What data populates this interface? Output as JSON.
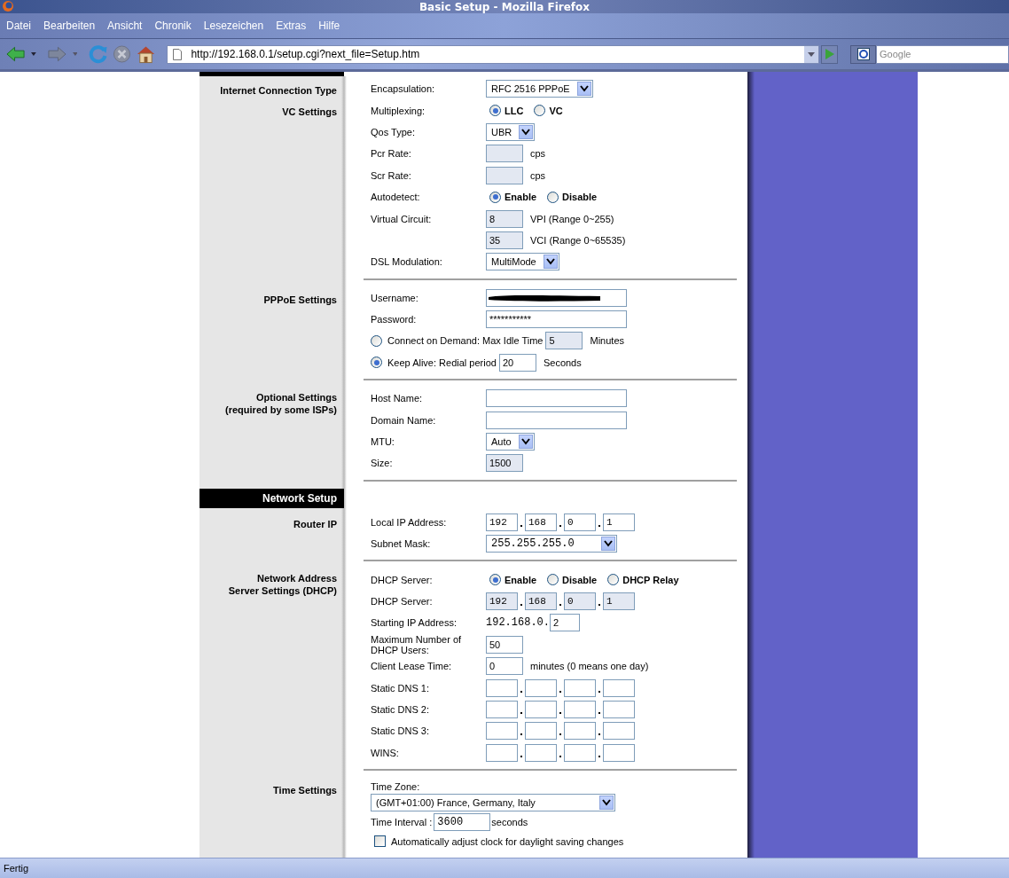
{
  "window": {
    "title": "Basic Setup - Mozilla Firefox"
  },
  "menu": [
    "Datei",
    "Bearbeiten",
    "Ansicht",
    "Chronik",
    "Lesezeichen",
    "Extras",
    "Hilfe"
  ],
  "toolbar": {
    "url": "http://192.168.0.1/setup.cgi?next_file=Setup.htm",
    "search_placeholder": "Google"
  },
  "groups": [
    {
      "kind": "group",
      "heading": [
        "Internet Connection Type"
      ],
      "divider": false,
      "rows": [
        {
          "kind": "select",
          "label": "Encapsulation:",
          "value": "RFC 2516 PPPoE"
        }
      ]
    },
    {
      "kind": "group",
      "heading": [
        "VC Settings"
      ],
      "divider": true,
      "rows": [
        {
          "kind": "radio",
          "label": "Multiplexing:",
          "options": [
            {
              "label": "LLC",
              "selected": true
            },
            {
              "label": "VC",
              "selected": false
            }
          ]
        },
        {
          "kind": "select",
          "label": "Qos Type:",
          "value": "UBR"
        },
        {
          "kind": "field",
          "label": "Pcr Rate:",
          "suffix": "cps",
          "disabled": true
        },
        {
          "kind": "field",
          "label": "Scr Rate:",
          "suffix": "cps",
          "disabled": true
        },
        {
          "kind": "radio",
          "label": "Autodetect:",
          "options": [
            {
              "label": "Enable",
              "selected": true
            },
            {
              "label": "Disable",
              "selected": false
            }
          ]
        },
        {
          "kind": "field",
          "label": "Virtual Circuit:",
          "value": "8",
          "suffix": "VPI (Range 0~255)",
          "disabled": true
        },
        {
          "kind": "field",
          "value": "35",
          "suffix": "VCI (Range 0~65535)",
          "disabled": true
        },
        {
          "kind": "select",
          "label": "DSL Modulation:",
          "value": "MultiMode"
        }
      ]
    },
    {
      "kind": "group",
      "heading": [
        "PPPoE Settings"
      ],
      "divider": true,
      "rows": [
        {
          "kind": "text",
          "label": "Username:",
          "redacted": true
        },
        {
          "kind": "text",
          "label": "Password:",
          "value": "***********",
          "redacted": false
        },
        {
          "kind": "radio-field",
          "label": "Connect on Demand: Max Idle Time",
          "selected": false,
          "value": "5",
          "suffix": "Minutes",
          "disabled": true
        },
        {
          "kind": "radio-field",
          "label": "Keep Alive: Redial period",
          "selected": true,
          "value": "20",
          "suffix": "Seconds",
          "disabled": false
        }
      ]
    },
    {
      "kind": "group",
      "heading": [
        "Optional Settings",
        "(required by some ISPs)"
      ],
      "divider": true,
      "rows": [
        {
          "kind": "text",
          "label": "Host Name:",
          "redacted": false
        },
        {
          "kind": "text",
          "label": "Domain Name:",
          "redacted": false
        },
        {
          "kind": "select",
          "label": "MTU:",
          "value": "Auto"
        },
        {
          "kind": "field",
          "label": "Size:",
          "value": "1500",
          "disabled": true
        }
      ]
    },
    {
      "kind": "section",
      "heading": [
        "Network Setup"
      ]
    },
    {
      "kind": "group",
      "heading": [
        "Router IP"
      ],
      "divider": true,
      "rows": [
        {
          "kind": "ip",
          "label": "Local IP Address:",
          "octets": [
            "192",
            "168",
            "0",
            "1"
          ],
          "disabled": false
        },
        {
          "kind": "select",
          "label": "Subnet Mask:",
          "value": "255.255.255.0"
        }
      ]
    },
    {
      "kind": "group",
      "heading": [
        "Network Address",
        "Server Settings (DHCP)"
      ],
      "divider": true,
      "rows": [
        {
          "kind": "radio",
          "label": "DHCP Server:",
          "options": [
            {
              "label": "Enable",
              "selected": true
            },
            {
              "label": "Disable",
              "selected": false
            },
            {
              "label": "DHCP Relay",
              "selected": false
            }
          ]
        },
        {
          "kind": "ip",
          "label": "DHCP Server:",
          "octets": [
            "192",
            "168",
            "0",
            "1"
          ],
          "disabled": true
        },
        {
          "kind": "prefix-field",
          "label": "Starting IP Address:",
          "prefix": "192.168.0.",
          "value": "2"
        },
        {
          "kind": "field",
          "label": "Maximum Number of DHCP Users:",
          "value": "50",
          "disabled": false
        },
        {
          "kind": "field",
          "label": "Client Lease Time:",
          "value": "0",
          "suffix": "minutes (0 means one day)",
          "disabled": false
        },
        {
          "kind": "ip",
          "label": "Static DNS 1:",
          "disabled": false
        },
        {
          "kind": "ip",
          "label": "Static DNS 2:",
          "disabled": false
        },
        {
          "kind": "ip",
          "label": "Static DNS 3:",
          "disabled": false
        },
        {
          "kind": "ip",
          "label": "WINS:",
          "disabled": false
        }
      ]
    },
    {
      "kind": "group",
      "heading": [
        "Time Settings"
      ],
      "divider": false,
      "rows": [
        {
          "kind": "select-block",
          "label": "Time Zone:",
          "value": "(GMT+01:00) France, Germany, Italy"
        },
        {
          "kind": "inline-field",
          "label": "Time Interval :",
          "value": "3600",
          "suffix": "seconds"
        },
        {
          "kind": "checkbox",
          "label": "Automatically adjust clock for daylight saving changes",
          "checked": false
        }
      ]
    }
  ],
  "status_bar": "Fertig"
}
